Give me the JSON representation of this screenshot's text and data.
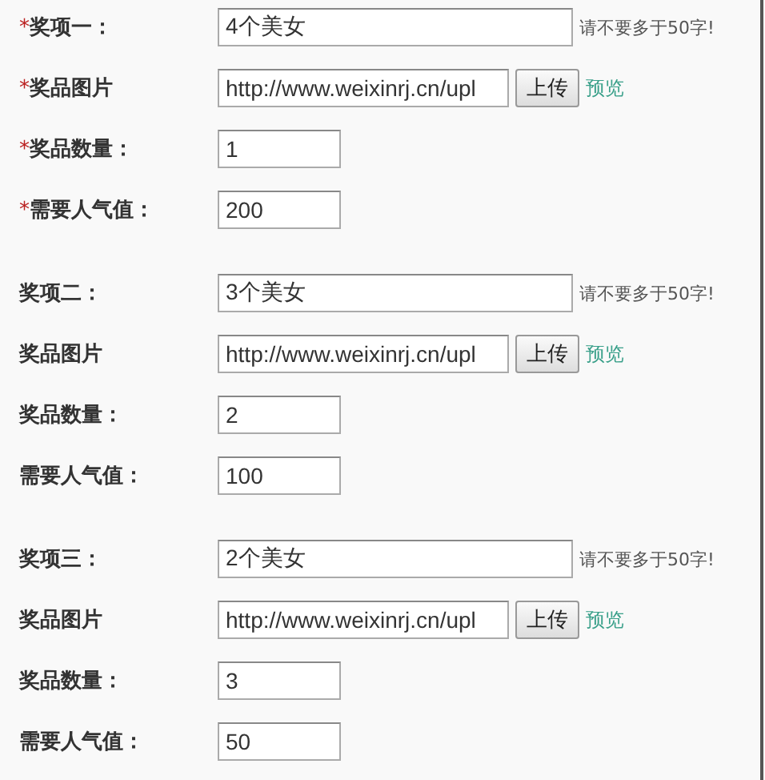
{
  "sections": [
    {
      "fields": [
        {
          "kind": "text",
          "mark": "*",
          "label": "奖项一：",
          "value": "4个美女",
          "hint": "请不要多于50字!"
        },
        {
          "kind": "upload",
          "mark": "*",
          "label": "奖品图片",
          "value": "http://www.weixinrj.cn/upl",
          "button": "上传",
          "link": "预览"
        },
        {
          "kind": "short",
          "mark": "*",
          "label": "奖品数量：",
          "value": "1"
        },
        {
          "kind": "short",
          "mark": "*",
          "label": "需要人气值：",
          "value": "200"
        }
      ]
    },
    {
      "fields": [
        {
          "kind": "text",
          "label": "奖项二：",
          "value": "3个美女",
          "hint": "请不要多于50字!"
        },
        {
          "kind": "upload",
          "label": "奖品图片",
          "value": "http://www.weixinrj.cn/upl",
          "button": "上传",
          "link": "预览"
        },
        {
          "kind": "short",
          "label": "奖品数量：",
          "value": "2"
        },
        {
          "kind": "short",
          "label": "需要人气值：",
          "value": "100"
        }
      ]
    },
    {
      "fields": [
        {
          "kind": "text",
          "label": "奖项三：",
          "value": "2个美女",
          "hint": "请不要多于50字!"
        },
        {
          "kind": "upload",
          "label": "奖品图片",
          "value": "http://www.weixinrj.cn/upl",
          "button": "上传",
          "link": "预览"
        },
        {
          "kind": "short",
          "label": "奖品数量：",
          "value": "3"
        },
        {
          "kind": "short",
          "label": "需要人气值：",
          "value": "50"
        }
      ]
    }
  ]
}
